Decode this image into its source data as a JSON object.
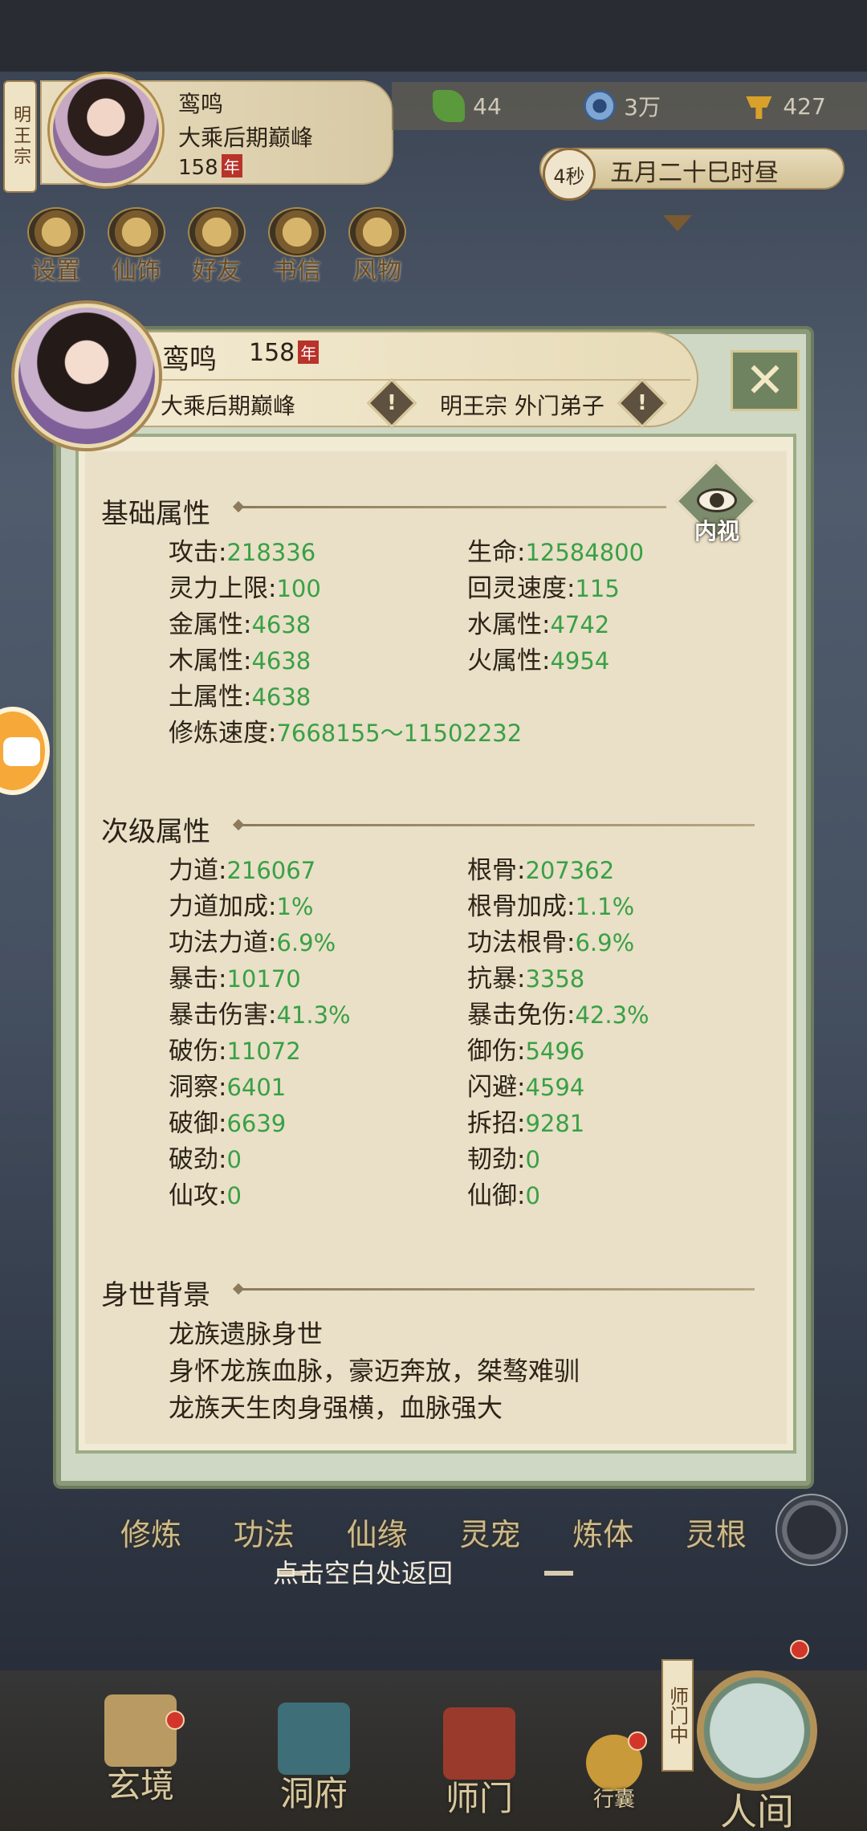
{
  "top": {
    "sect_tag": "明王宗",
    "name": "鸾鸣",
    "realm": "大乘后期巅峰",
    "age": "158",
    "age_unit": "年",
    "resources": [
      {
        "icon": "leaf-icon",
        "value": "44"
      },
      {
        "icon": "coin-icon",
        "value": "3万"
      },
      {
        "icon": "gold-ingot-icon",
        "value": "427"
      }
    ],
    "timer": "4秒",
    "date_time": "五月二十巳时昼",
    "menu": [
      {
        "label": "设置",
        "icon": "settings-icon"
      },
      {
        "label": "仙饰",
        "icon": "ornament-icon"
      },
      {
        "label": "好友",
        "icon": "friends-icon"
      },
      {
        "label": "书信",
        "icon": "letter-icon"
      },
      {
        "label": "风物",
        "icon": "scenery-icon"
      }
    ]
  },
  "dialog": {
    "name": "鸾鸣",
    "age": "158",
    "age_unit": "年",
    "realm": "大乘后期巅峰",
    "sect": "明王宗 外门弟子",
    "inner_view_label": "内视",
    "basic": {
      "title": "基础属性",
      "stats": [
        {
          "label": "攻击:",
          "value": "218336"
        },
        {
          "label": "生命:",
          "value": "12584800"
        },
        {
          "label": "灵力上限:",
          "value": "100"
        },
        {
          "label": "回灵速度:",
          "value": "115"
        },
        {
          "label": "金属性:",
          "value": "4638"
        },
        {
          "label": "水属性:",
          "value": "4742"
        },
        {
          "label": "木属性:",
          "value": "4638"
        },
        {
          "label": "火属性:",
          "value": "4954"
        },
        {
          "label": "土属性:",
          "value": "4638"
        },
        {
          "label": "修炼速度:",
          "value": "7668155～11502232"
        }
      ]
    },
    "secondary": {
      "title": "次级属性",
      "stats": [
        {
          "label": "力道:",
          "value": "216067"
        },
        {
          "label": "根骨:",
          "value": "207362"
        },
        {
          "label": "力道加成:",
          "value": "1%"
        },
        {
          "label": "根骨加成:",
          "value": "1.1%"
        },
        {
          "label": "功法力道:",
          "value": "6.9%"
        },
        {
          "label": "功法根骨:",
          "value": "6.9%"
        },
        {
          "label": "暴击:",
          "value": "10170"
        },
        {
          "label": "抗暴:",
          "value": "3358"
        },
        {
          "label": "暴击伤害:",
          "value": "41.3%"
        },
        {
          "label": "暴击免伤:",
          "value": "42.3%"
        },
        {
          "label": "破伤:",
          "value": "11072"
        },
        {
          "label": "御伤:",
          "value": "5496"
        },
        {
          "label": "洞察:",
          "value": "6401"
        },
        {
          "label": "闪避:",
          "value": "4594"
        },
        {
          "label": "破御:",
          "value": "6639"
        },
        {
          "label": "拆招:",
          "value": "9281"
        },
        {
          "label": "破劲:",
          "value": "0"
        },
        {
          "label": "韧劲:",
          "value": "0"
        },
        {
          "label": "仙攻:",
          "value": "0"
        },
        {
          "label": "仙御:",
          "value": "0"
        }
      ]
    },
    "background": {
      "title": "身世背景",
      "lines": [
        "龙族遗脉身世",
        "身怀龙族血脉，豪迈奔放，桀骜难驯",
        "龙族天生肉身强横，血脉强大"
      ]
    }
  },
  "sub_menu": [
    "修炼",
    "功法",
    "仙缘",
    "灵宠",
    "炼体",
    "灵根"
  ],
  "return_hint": "点击空白处返回",
  "bottom_nav": [
    {
      "label": "玄境",
      "icon": "scroll-icon"
    },
    {
      "label": "洞府",
      "icon": "pavilion-icon"
    },
    {
      "label": "师门",
      "icon": "banner-icon"
    },
    {
      "label": "行囊",
      "icon": "bag-icon"
    },
    {
      "label": "人间",
      "icon": "world-icon"
    }
  ],
  "shimen_tag": "师门中",
  "colors": {
    "stat_value": "#39a045",
    "accent_red": "#b8332a"
  }
}
